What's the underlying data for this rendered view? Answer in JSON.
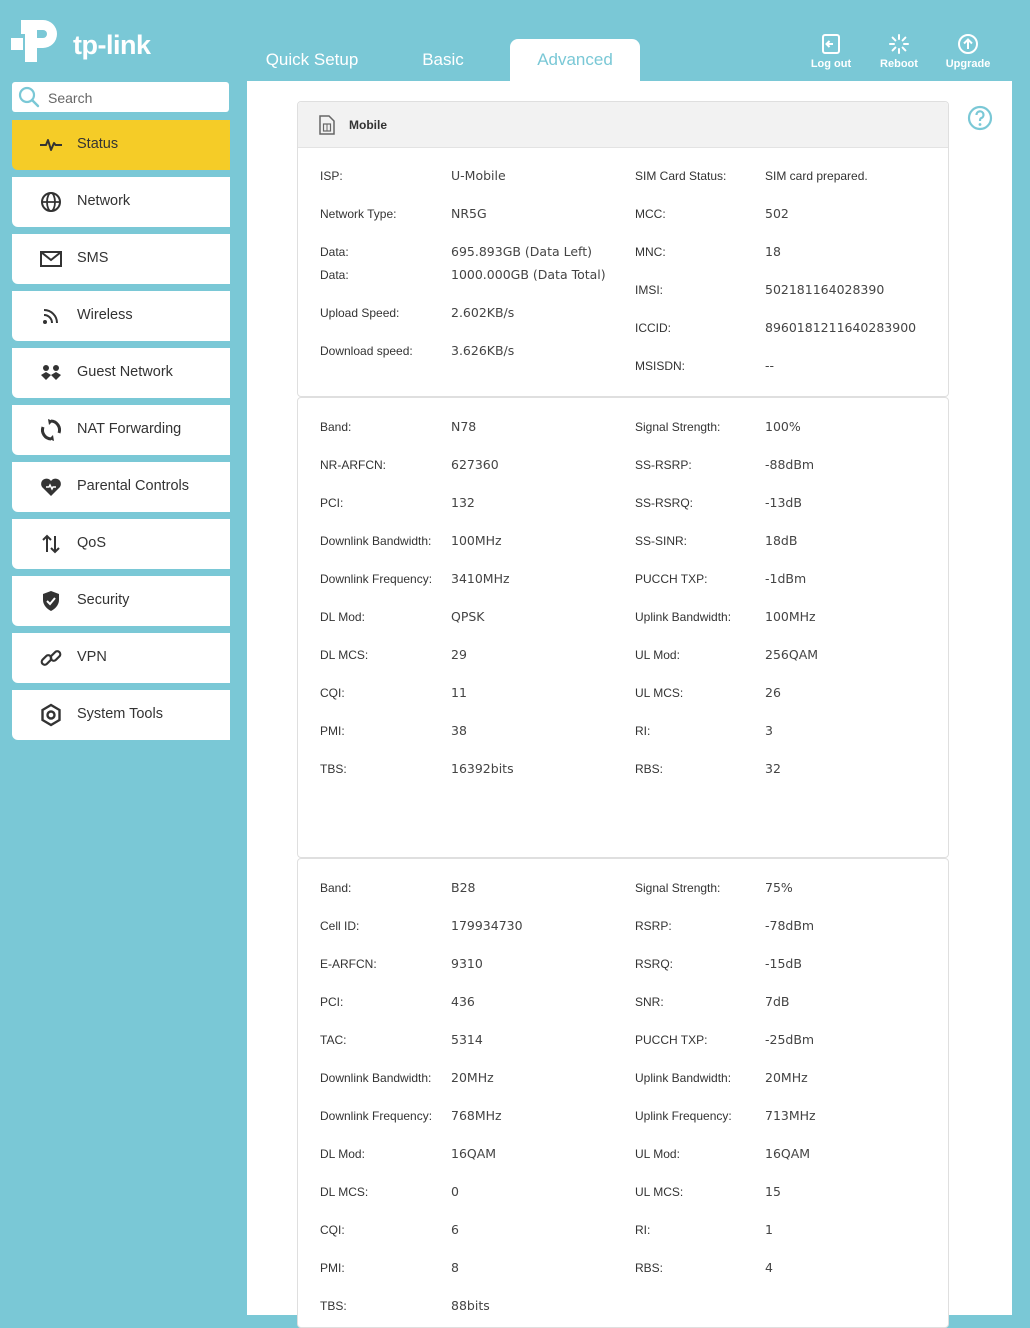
{
  "brand": {
    "logo_text": "tp-link"
  },
  "tabs": [
    {
      "label": "Quick Setup",
      "active": false
    },
    {
      "label": "Basic",
      "active": false
    },
    {
      "label": "Advanced",
      "active": true
    }
  ],
  "actions": {
    "logout": "Log out",
    "reboot": "Reboot",
    "upgrade": "Upgrade"
  },
  "search": {
    "placeholder": "Search"
  },
  "sidebar": {
    "items": [
      {
        "label": "Status",
        "icon": "pulse-icon",
        "active": true
      },
      {
        "label": "Network",
        "icon": "globe-icon"
      },
      {
        "label": "SMS",
        "icon": "envelope-icon"
      },
      {
        "label": "Wireless",
        "icon": "wifi-icon"
      },
      {
        "label": "Guest Network",
        "icon": "guest-icon"
      },
      {
        "label": "NAT Forwarding",
        "icon": "nat-icon"
      },
      {
        "label": "Parental Controls",
        "icon": "heart-icon"
      },
      {
        "label": "QoS",
        "icon": "qos-arrows-icon"
      },
      {
        "label": "Security",
        "icon": "shield-icon"
      },
      {
        "label": "VPN",
        "icon": "chain-link-icon"
      },
      {
        "label": "System Tools",
        "icon": "gear-icon"
      }
    ]
  },
  "mobile": {
    "title": "Mobile",
    "left": [
      {
        "label": "ISP:",
        "value": "U-Mobile"
      },
      {
        "label": "Network Type:",
        "value": "NR5G"
      },
      {
        "label": "Data:",
        "value": "695.893GB (Data Left)"
      },
      {
        "label": "Data:",
        "value": "1000.000GB (Data Total)"
      },
      {
        "label": "Upload Speed:",
        "value": "2.602KB/s"
      },
      {
        "label": "Download speed:",
        "value": "3.626KB/s"
      }
    ],
    "right": [
      {
        "label": "SIM Card Status:",
        "value": "SIM card prepared."
      },
      {
        "label": "MCC:",
        "value": "502"
      },
      {
        "label": "MNC:",
        "value": "18"
      },
      {
        "label": "IMSI:",
        "value": "502181164028390"
      },
      {
        "label": "ICCID:",
        "value": "8960181211640283900"
      },
      {
        "label": "MSISDN:",
        "value": "--"
      }
    ]
  },
  "nr": {
    "left": [
      {
        "label": "Band:",
        "value": "N78"
      },
      {
        "label": "NR-ARFCN:",
        "value": "627360"
      },
      {
        "label": "PCI:",
        "value": "132"
      },
      {
        "label": "Downlink Bandwidth:",
        "value": "100MHz"
      },
      {
        "label": "Downlink Frequency:",
        "value": "3410MHz"
      },
      {
        "label": "DL Mod:",
        "value": "QPSK"
      },
      {
        "label": "DL MCS:",
        "value": "29"
      },
      {
        "label": "CQI:",
        "value": "11"
      },
      {
        "label": "PMI:",
        "value": "38"
      },
      {
        "label": "TBS:",
        "value": "16392bits"
      }
    ],
    "right": [
      {
        "label": "Signal Strength:",
        "value": "100%"
      },
      {
        "label": "SS-RSRP:",
        "value": "-88dBm"
      },
      {
        "label": "SS-RSRQ:",
        "value": "-13dB"
      },
      {
        "label": "SS-SINR:",
        "value": "18dB"
      },
      {
        "label": "PUCCH TXP:",
        "value": "-1dBm"
      },
      {
        "label": "Uplink Bandwidth:",
        "value": "100MHz"
      },
      {
        "label": "UL Mod:",
        "value": "256QAM"
      },
      {
        "label": "UL MCS:",
        "value": "26"
      },
      {
        "label": "RI:",
        "value": "3"
      },
      {
        "label": "RBS:",
        "value": "32"
      }
    ]
  },
  "lte": {
    "left": [
      {
        "label": "Band:",
        "value": "B28"
      },
      {
        "label": "Cell ID:",
        "value": "179934730"
      },
      {
        "label": "E-ARFCN:",
        "value": "9310"
      },
      {
        "label": "PCI:",
        "value": "436"
      },
      {
        "label": "TAC:",
        "value": "5314"
      },
      {
        "label": "Downlink Bandwidth:",
        "value": "20MHz"
      },
      {
        "label": "Downlink Frequency:",
        "value": "768MHz"
      },
      {
        "label": "DL Mod:",
        "value": "16QAM"
      },
      {
        "label": "DL MCS:",
        "value": "0"
      },
      {
        "label": "CQI:",
        "value": "6"
      },
      {
        "label": "PMI:",
        "value": "8"
      },
      {
        "label": "TBS:",
        "value": "88bits"
      }
    ],
    "right": [
      {
        "label": "Signal Strength:",
        "value": "75%"
      },
      {
        "label": "RSRP:",
        "value": "-78dBm"
      },
      {
        "label": "RSRQ:",
        "value": "-15dB"
      },
      {
        "label": "SNR:",
        "value": "7dB"
      },
      {
        "label": "PUCCH TXP:",
        "value": "-25dBm"
      },
      {
        "label": "Uplink Bandwidth:",
        "value": "20MHz"
      },
      {
        "label": "Uplink Frequency:",
        "value": "713MHz"
      },
      {
        "label": "UL Mod:",
        "value": "16QAM"
      },
      {
        "label": "UL MCS:",
        "value": "15"
      },
      {
        "label": "RI:",
        "value": "1"
      },
      {
        "label": "RBS:",
        "value": "4"
      }
    ]
  },
  "colors": {
    "background": "#7ac8d6",
    "active_nav": "#f5cc27",
    "panel": "#ffffff"
  }
}
